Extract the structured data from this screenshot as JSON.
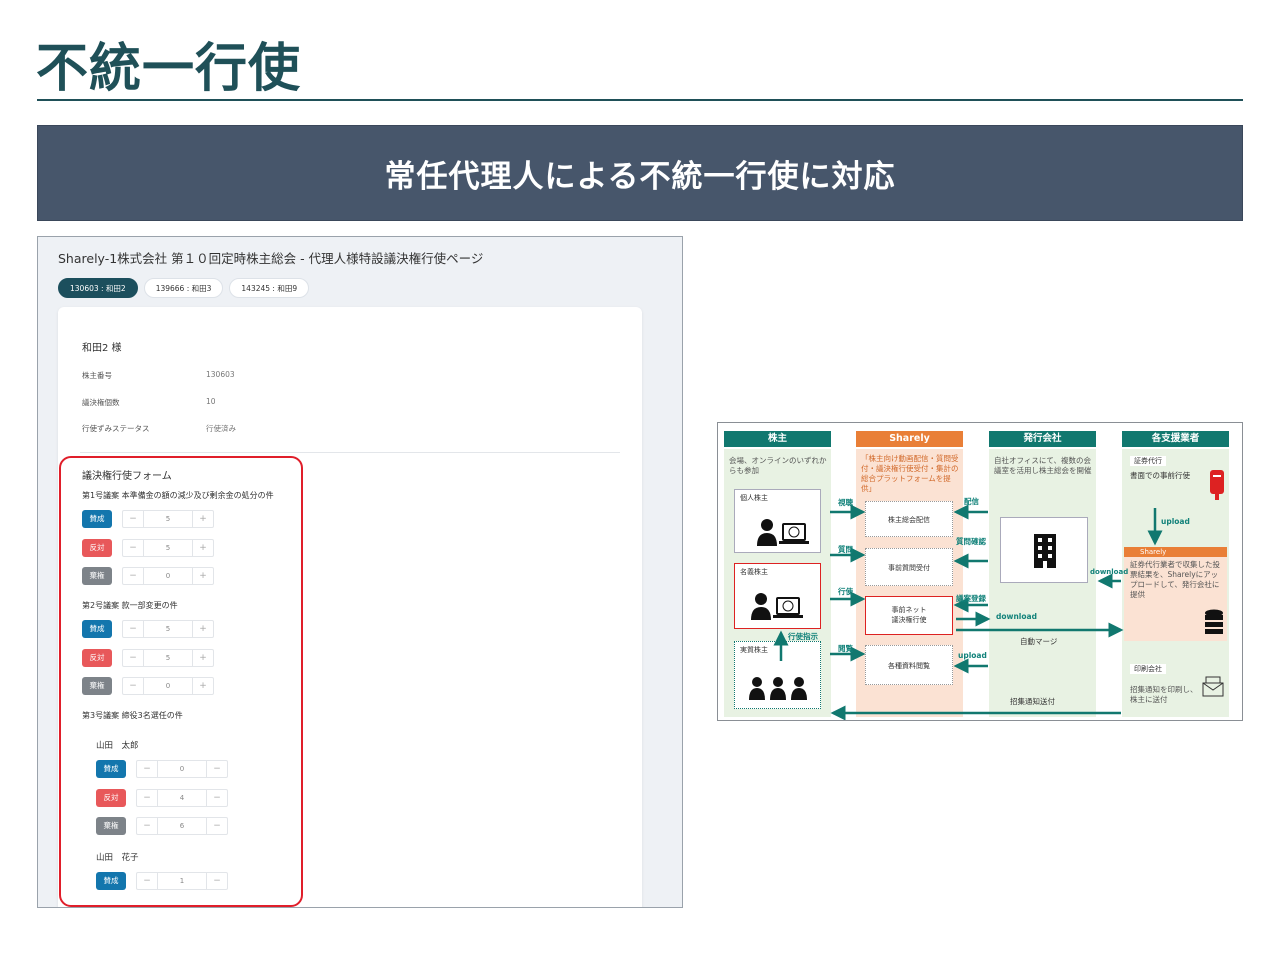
{
  "slide": {
    "title": "不統一行使",
    "banner": "常任代理人による不統一行使に対応"
  },
  "app": {
    "page_title": "Sharely-1株式会社 第１０回定時株主総会 - 代理人様特設議決権行使ページ",
    "tabs": [
      {
        "label": "130603 : 和田2",
        "active": true
      },
      {
        "label": "139666 : 和田3",
        "active": false
      },
      {
        "label": "143245 : 和田9",
        "active": false
      }
    ],
    "holder": {
      "name": "和田2 様",
      "fields": [
        {
          "label": "株主番号",
          "value": "130603"
        },
        {
          "label": "議決権個数",
          "value": "10"
        },
        {
          "label": "行使ずみステータス",
          "value": "行使済み"
        }
      ]
    },
    "form": {
      "title": "議決権行使フォーム",
      "proposals": [
        {
          "title": "第1号議案 本準備金の額の減少及び剰余金の処分の件",
          "votes": [
            {
              "label": "賛成",
              "kind": "approve",
              "value": "5"
            },
            {
              "label": "反対",
              "kind": "oppose",
              "value": "5"
            },
            {
              "label": "棄権",
              "kind": "abstain",
              "value": "0"
            }
          ]
        },
        {
          "title": "第2号議案 款一部変更の件",
          "votes": [
            {
              "label": "賛成",
              "kind": "approve",
              "value": "5"
            },
            {
              "label": "反対",
              "kind": "oppose",
              "value": "5"
            },
            {
              "label": "棄権",
              "kind": "abstain",
              "value": "0"
            }
          ]
        },
        {
          "title": "第3号議案 締役3名選任の件",
          "candidates": [
            {
              "name": "山田　太郎",
              "votes": [
                {
                  "label": "賛成",
                  "kind": "approve",
                  "value": "0"
                },
                {
                  "label": "反対",
                  "kind": "oppose",
                  "value": "4"
                },
                {
                  "label": "棄権",
                  "kind": "abstain",
                  "value": "6"
                }
              ]
            },
            {
              "name": "山田　花子",
              "votes": [
                {
                  "label": "賛成",
                  "kind": "approve",
                  "value": "1"
                }
              ]
            }
          ]
        }
      ],
      "stepper_minus": "−",
      "stepper_plus": "+"
    }
  },
  "diagram": {
    "columns": {
      "shareholder": {
        "head": "株主",
        "desc": "会場、オンラインのいずれからも参加",
        "color": "#11786f"
      },
      "sharely": {
        "head": "Sharely",
        "desc": "「株主向け動画配信・質問受付・議決権行使受付・集計の総合プラットフォームを提供」",
        "color": "#e97f37"
      },
      "issuer": {
        "head": "発行会社",
        "desc": "自社オフィスにて、複数の会議室を活用し株主総会を開催",
        "color": "#11786f"
      },
      "support": {
        "head": "各支援業者",
        "color": "#11786f"
      }
    },
    "shareholder_boxes": {
      "individual": "個人株主",
      "nominee": "名義株主",
      "beneficial": "実質株主"
    },
    "sharely_boxes": {
      "delivery": "株主総会配信",
      "qa": "事前質問受付",
      "vote": "事前ネット\n議決権行使",
      "docs": "各種資料閲覧"
    },
    "labels": {
      "watch": "視聴",
      "question": "質問",
      "exercise": "行使",
      "browse": "閲覧",
      "instruction": "行使指示",
      "distribute": "配信",
      "check_q": "質問確認",
      "register": "議案登録",
      "download": "download",
      "upload": "upload",
      "merge": "自動マージ",
      "notice": "招集通知送付",
      "download2": "download",
      "upload2": "upload"
    },
    "support": {
      "agent_title": "証券代行",
      "agent_desc": "書面での事前行使",
      "sharely_title": "Sharely",
      "sharely_desc": "証券代行業者で収集した投票結果を、Sharelyにアップロードして、発行会社に提供",
      "print_title": "印刷会社",
      "print_desc": "招集通知を印刷し、株主に送付"
    }
  }
}
